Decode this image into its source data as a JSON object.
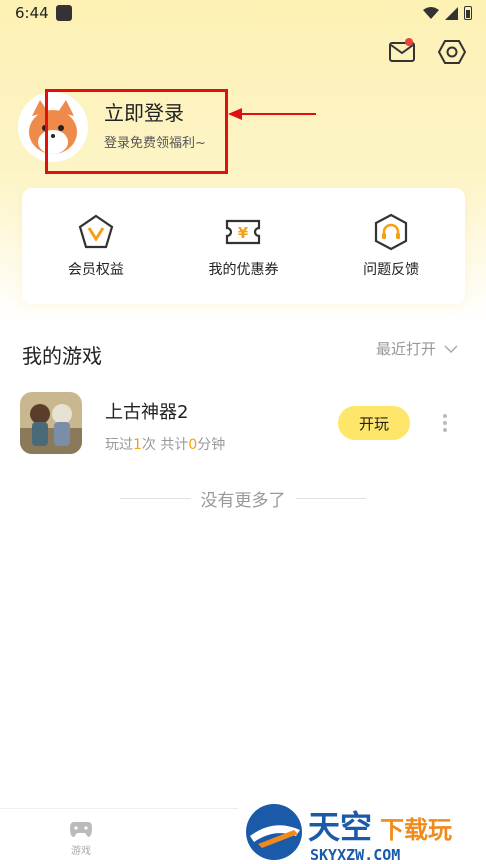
{
  "status_bar": {
    "time": "6:44"
  },
  "profile": {
    "title": "立即登录",
    "subtitle": "登录免费领福利~"
  },
  "quick_actions": [
    {
      "label": "会员权益",
      "icon": "vip-v-icon"
    },
    {
      "label": "我的优惠券",
      "icon": "coupon-yen-icon"
    },
    {
      "label": "问题反馈",
      "icon": "headset-icon"
    }
  ],
  "my_games": {
    "title": "我的游戏",
    "sort_label": "最近打开",
    "games": [
      {
        "name": "上古神器2",
        "stats_prefix": "玩过",
        "play_count": "1",
        "stats_mid": "次 共计",
        "minutes": "0",
        "stats_suffix": "分钟",
        "play_label": "开玩"
      }
    ],
    "end_text": "没有更多了"
  },
  "bottom_nav": {
    "game_label": "游戏"
  },
  "watermark": {
    "brand_cn_a": "天空",
    "brand_cn_b": "下载玩",
    "domain": "SKYXZW.COM"
  },
  "colors": {
    "accent_yellow": "#fde66a",
    "highlight_orange": "#f4a012",
    "annotation_red": "#e01010"
  }
}
